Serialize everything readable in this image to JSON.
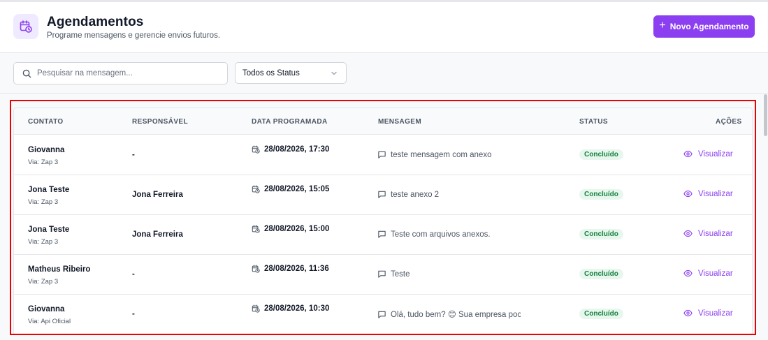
{
  "header": {
    "title": "Agendamentos",
    "subtitle": "Programe mensagens e gerencie envios futuros.",
    "new_button": "Novo Agendamento",
    "icon": "calendar-clock-icon"
  },
  "filters": {
    "search_placeholder": "Pesquisar na mensagem...",
    "status_select": "Todos os Status"
  },
  "table": {
    "columns": [
      "CONTATO",
      "RESPONSÁVEL",
      "DATA PROGRAMADA",
      "MENSAGEM",
      "STATUS",
      "AÇÕES"
    ],
    "rows": [
      {
        "contact": "Giovanna",
        "via": "Via: Zap 3",
        "responsible": "-",
        "date": "28/08/2026, 17:30",
        "message": "teste mensagem com anexo",
        "status": "Concluído",
        "action": "Visualizar"
      },
      {
        "contact": "Jona Teste",
        "via": "Via: Zap 3",
        "responsible": "Jona Ferreira",
        "date": "28/08/2026, 15:05",
        "message": "teste anexo 2",
        "status": "Concluído",
        "action": "Visualizar"
      },
      {
        "contact": "Jona Teste",
        "via": "Via: Zap 3",
        "responsible": "Jona Ferreira",
        "date": "28/08/2026, 15:00",
        "message": "Teste com arquivos anexos.",
        "status": "Concluído",
        "action": "Visualizar"
      },
      {
        "contact": "Matheus Ribeiro",
        "via": "Via: Zap 3",
        "responsible": "-",
        "date": "28/08/2026, 11:36",
        "message": "Teste",
        "status": "Concluído",
        "action": "Visualizar"
      },
      {
        "contact": "Giovanna",
        "via": "Via: Api Oficial",
        "responsible": "-",
        "date": "28/08/2026, 10:30",
        "message": "Olá, tudo bem? 😊 Sua empresa poc",
        "status": "Concluído",
        "action": "Visualizar"
      }
    ]
  },
  "colors": {
    "accent": "#8b3ff0",
    "status_bg": "#e7f7ee",
    "status_text": "#15803d",
    "highlight": "#ee0000"
  }
}
